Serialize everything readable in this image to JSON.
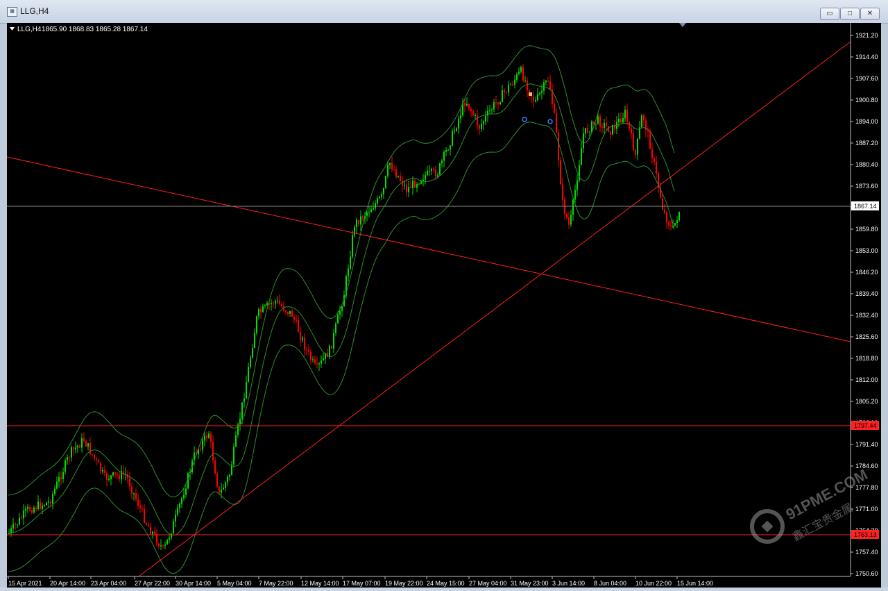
{
  "window": {
    "title": "LLG,H4",
    "min_label": "▭",
    "max_label": "□",
    "close_label": "✕"
  },
  "chart": {
    "header_symbol": "LLG,H4",
    "header_ohlc": "1865.90 1868.83 1865.28 1867.14",
    "price_axis": [
      "1921.20",
      "1914.40",
      "1907.60",
      "1900.80",
      "1894.00",
      "1887.20",
      "1880.40",
      "1873.60",
      "1866.80",
      "1859.80",
      "1853.00",
      "1846.20",
      "1839.40",
      "1832.40",
      "1825.60",
      "1818.80",
      "1812.00",
      "1805.20",
      "1798.20",
      "1791.40",
      "1784.60",
      "1777.80",
      "1771.00",
      "1764.20",
      "1757.40",
      "1750.60"
    ],
    "time_axis": [
      "15 Apr 2021",
      "20 Apr 14:00",
      "23 Apr 04:00",
      "27 Apr 22:00",
      "30 Apr 14:00",
      "5 May 04:00",
      "7 May 22:00",
      "12 May 14:00",
      "17 May 07:00",
      "19 May 22:00",
      "24 May 15:00",
      "27 May 04:00",
      "31 May 23:00",
      "3 Jun 14:00",
      "8 Jun 04:00",
      "10 Jun 22:00",
      "15 Jun 14:00"
    ],
    "current_price_label": "1867.14",
    "level_upper_label": "1797.44",
    "level_lower_label": "1763.13",
    "colors": {
      "bull": "#00e000",
      "bear": "#ff0000",
      "band": "#2f8f2f",
      "line": "#ff2020",
      "grid": "#808080"
    }
  },
  "watermark": {
    "brand": "91PME.COM",
    "tagline": "鑫汇宝贵金属"
  }
}
